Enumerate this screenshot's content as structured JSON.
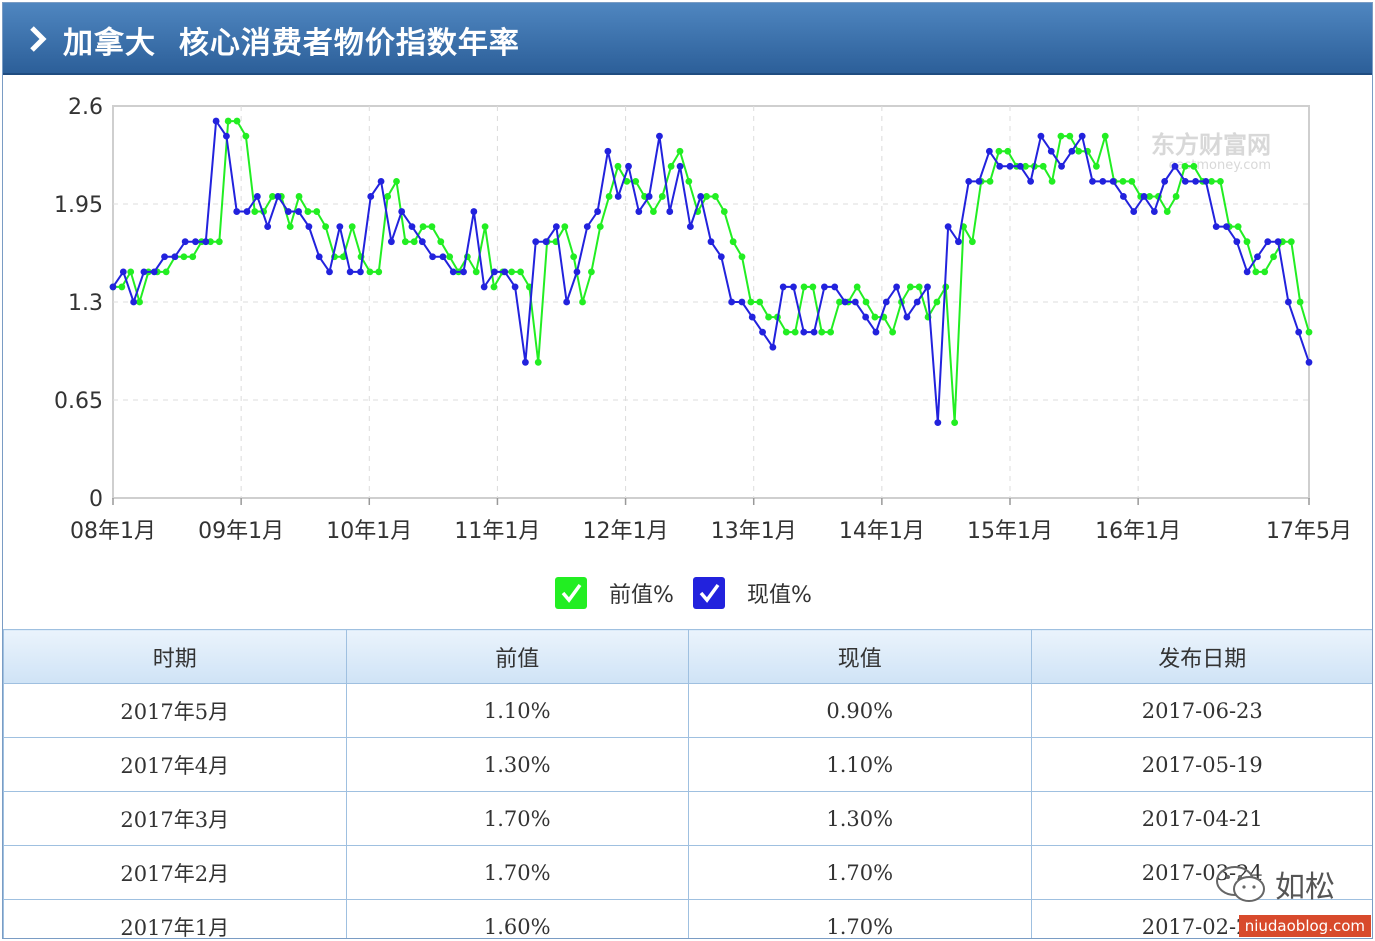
{
  "header": {
    "title": "加拿大  核心消费者物价指数年率",
    "icon": "chevron-right-icon"
  },
  "colors": {
    "prev": "#22ee22",
    "curr": "#2222dd",
    "header": "#3a6ea8"
  },
  "chart_data": {
    "type": "line",
    "ylim": [
      0,
      2.6
    ],
    "yticks": [
      "2.6",
      "1.95",
      "1.3",
      "0.65",
      "0"
    ],
    "xticks": [
      "08年1月",
      "09年1月",
      "10年1月",
      "11年1月",
      "12年1月",
      "13年1月",
      "14年1月",
      "15年1月",
      "16年1月",
      "17年5月"
    ],
    "start": "2008-01",
    "end": "2017-05",
    "series": [
      {
        "name": "前值%",
        "values": [
          1.4,
          1.4,
          1.5,
          1.3,
          1.5,
          1.5,
          1.5,
          1.6,
          1.6,
          1.6,
          1.7,
          1.7,
          1.7,
          2.5,
          2.5,
          2.4,
          1.9,
          1.9,
          2.0,
          2.0,
          1.8,
          2.0,
          1.9,
          1.9,
          1.8,
          1.6,
          1.6,
          1.8,
          1.6,
          1.5,
          1.5,
          2.0,
          2.1,
          1.7,
          1.7,
          1.8,
          1.8,
          1.7,
          1.6,
          1.5,
          1.6,
          1.5,
          1.8,
          1.4,
          1.5,
          1.5,
          1.5,
          1.4,
          0.9,
          1.7,
          1.7,
          1.8,
          1.6,
          1.3,
          1.5,
          1.8,
          2.0,
          2.2,
          2.1,
          2.1,
          2.0,
          1.9,
          2.0,
          2.2,
          2.3,
          2.1,
          1.9,
          2.0,
          2.0,
          1.9,
          1.7,
          1.6,
          1.3,
          1.3,
          1.2,
          1.2,
          1.1,
          1.1,
          1.4,
          1.4,
          1.1,
          1.1,
          1.3,
          1.3,
          1.4,
          1.3,
          1.2,
          1.2,
          1.1,
          1.3,
          1.4,
          1.4,
          1.2,
          1.3,
          1.4,
          0.5,
          1.8,
          1.7,
          2.1,
          2.1,
          2.3,
          2.3,
          2.2,
          2.2,
          2.2,
          2.2,
          2.1,
          2.4,
          2.4,
          2.3,
          2.3,
          2.2,
          2.4,
          2.1,
          2.1,
          2.1,
          2.0,
          2.0,
          2.0,
          1.9,
          2.0,
          2.2,
          2.2,
          2.1,
          2.1,
          2.1,
          1.8,
          1.8,
          1.7,
          1.5,
          1.5,
          1.6,
          1.7,
          1.7,
          1.3,
          1.1
        ]
      },
      {
        "name": "现值%",
        "values": [
          1.4,
          1.5,
          1.3,
          1.5,
          1.5,
          1.6,
          1.6,
          1.7,
          1.7,
          1.7,
          2.5,
          2.4,
          1.9,
          1.9,
          2.0,
          1.8,
          2.0,
          1.9,
          1.9,
          1.8,
          1.6,
          1.5,
          1.8,
          1.5,
          1.5,
          2.0,
          2.1,
          1.7,
          1.9,
          1.8,
          1.7,
          1.6,
          1.6,
          1.5,
          1.5,
          1.9,
          1.4,
          1.5,
          1.5,
          1.4,
          0.9,
          1.7,
          1.7,
          1.8,
          1.3,
          1.5,
          1.8,
          1.9,
          2.3,
          2.0,
          2.2,
          1.9,
          2.0,
          2.4,
          1.9,
          2.2,
          1.8,
          2.0,
          1.7,
          1.6,
          1.3,
          1.3,
          1.2,
          1.1,
          1.0,
          1.4,
          1.4,
          1.1,
          1.1,
          1.4,
          1.4,
          1.3,
          1.3,
          1.2,
          1.1,
          1.3,
          1.4,
          1.2,
          1.3,
          1.4,
          0.5,
          1.8,
          1.7,
          2.1,
          2.1,
          2.3,
          2.2,
          2.2,
          2.2,
          2.1,
          2.4,
          2.3,
          2.2,
          2.3,
          2.4,
          2.1,
          2.1,
          2.1,
          2.0,
          1.9,
          2.0,
          1.9,
          2.1,
          2.2,
          2.1,
          2.1,
          2.1,
          1.8,
          1.8,
          1.7,
          1.5,
          1.6,
          1.7,
          1.7,
          1.3,
          1.1,
          0.9
        ]
      }
    ]
  },
  "legend": [
    {
      "label": "前值%",
      "color": "#22ee22"
    },
    {
      "label": "现值%",
      "color": "#2222dd"
    }
  ],
  "table": {
    "headers": [
      "时期",
      "前值",
      "现值",
      "发布日期"
    ],
    "rows": [
      [
        "2017年5月",
        "1.10%",
        "0.90%",
        "2017-06-23"
      ],
      [
        "2017年4月",
        "1.30%",
        "1.10%",
        "2017-05-19"
      ],
      [
        "2017年3月",
        "1.70%",
        "1.30%",
        "2017-04-21"
      ],
      [
        "2017年2月",
        "1.70%",
        "1.70%",
        "2017-03-24"
      ],
      [
        "2017年1月",
        "1.60%",
        "1.70%",
        "2017-02-24"
      ]
    ]
  },
  "watermark": {
    "brand": "东方财富网",
    "domain": "eastmoney.com",
    "author": "如松",
    "site": "niudaoblog.com",
    "icon": "wechat-icon"
  }
}
